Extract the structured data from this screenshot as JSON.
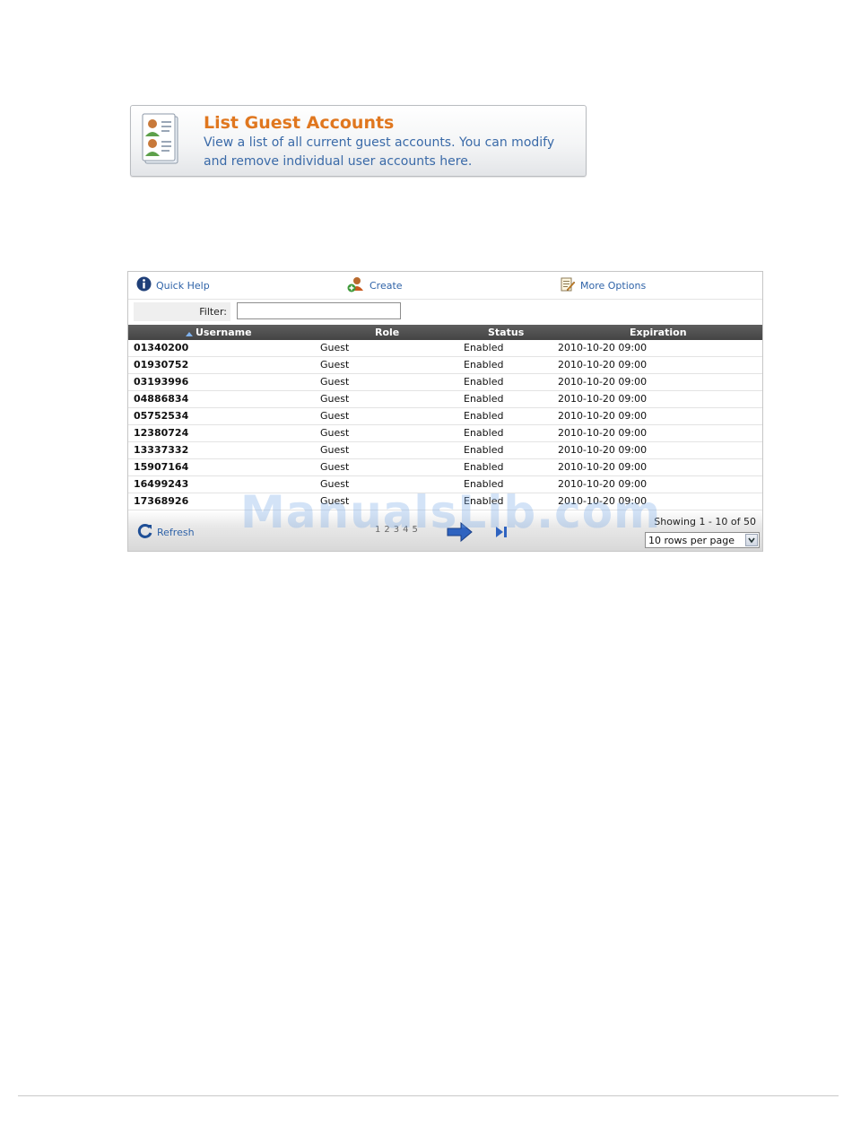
{
  "banner": {
    "title": "List Guest Accounts",
    "description_line1": "View a list of all current guest accounts. You can modify",
    "description_line2": "and remove individual user accounts here."
  },
  "toolbar": {
    "quick_help": "Quick Help",
    "create": "Create",
    "more_options": "More Options"
  },
  "filter": {
    "label": "Filter:",
    "value": ""
  },
  "table": {
    "columns": [
      "Username",
      "Role",
      "Status",
      "Expiration"
    ],
    "sort_column": "Username",
    "sort_direction": "asc",
    "rows": [
      {
        "username": "01340200",
        "role": "Guest",
        "status": "Enabled",
        "expiration": "2010-10-20 09:00"
      },
      {
        "username": "01930752",
        "role": "Guest",
        "status": "Enabled",
        "expiration": "2010-10-20 09:00"
      },
      {
        "username": "03193996",
        "role": "Guest",
        "status": "Enabled",
        "expiration": "2010-10-20 09:00"
      },
      {
        "username": "04886834",
        "role": "Guest",
        "status": "Enabled",
        "expiration": "2010-10-20 09:00"
      },
      {
        "username": "05752534",
        "role": "Guest",
        "status": "Enabled",
        "expiration": "2010-10-20 09:00"
      },
      {
        "username": "12380724",
        "role": "Guest",
        "status": "Enabled",
        "expiration": "2010-10-20 09:00"
      },
      {
        "username": "13337332",
        "role": "Guest",
        "status": "Enabled",
        "expiration": "2010-10-20 09:00"
      },
      {
        "username": "15907164",
        "role": "Guest",
        "status": "Enabled",
        "expiration": "2010-10-20 09:00"
      },
      {
        "username": "16499243",
        "role": "Guest",
        "status": "Enabled",
        "expiration": "2010-10-20 09:00"
      },
      {
        "username": "17368926",
        "role": "Guest",
        "status": "Enabled",
        "expiration": "2010-10-20 09:00"
      }
    ]
  },
  "footer": {
    "refresh": "Refresh",
    "pages": [
      "1",
      "2",
      "3",
      "4",
      "5"
    ],
    "current_page": "1",
    "showing": "Showing 1 - 10 of 50",
    "rows_per_page": "10 rows per page"
  },
  "watermark": "ManualsLib.com",
  "colors": {
    "title_orange": "#e0771f",
    "link_blue": "#2f63a8",
    "header_dark": "#4f4f4f"
  },
  "icons": {
    "banner": "guest-accounts-list-icon",
    "quick_help": "info-icon",
    "create": "create-user-icon",
    "more_options": "notepad-pencil-icon",
    "refresh": "refresh-icon",
    "next": "next-arrow-icon",
    "last": "last-page-icon",
    "sort": "sort-ascending-icon",
    "dropdown": "chevron-down-icon"
  }
}
